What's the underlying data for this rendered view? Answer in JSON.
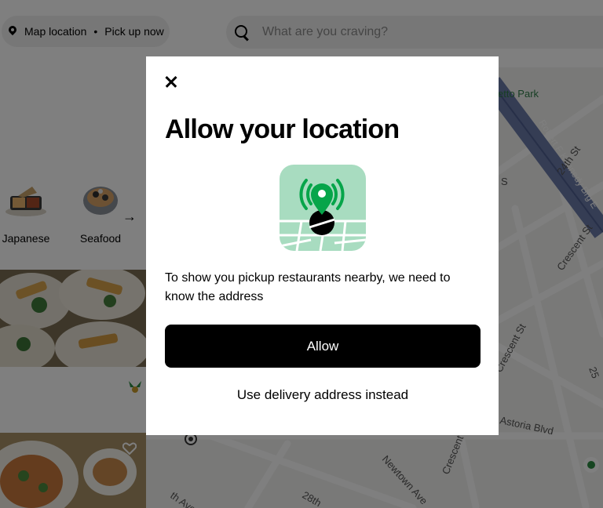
{
  "header": {
    "location_label": "Map location",
    "location_separator": "•",
    "pickup_label": "Pick up now",
    "search_placeholder": "What are you craving?"
  },
  "categories": [
    {
      "label": "Japanese",
      "icon": "sushi-bento-icon"
    },
    {
      "label": "Seafood",
      "icon": "seafood-bowl-icon"
    }
  ],
  "map": {
    "labels": {
      "park": "etto Park",
      "bridge": "Robert F Kennedy Brg E",
      "street_24th": "24th St",
      "crescent_st_1": "Crescent St",
      "crescent_st_2": "Crescent St",
      "crescent_st_3": "Crescent St",
      "street_25": "25",
      "astoria": "Astoria Blvd",
      "newtown": "Newtown Ave",
      "street_28th": "28th",
      "street_th": "th Ave",
      "s_fragment": "S"
    }
  },
  "modal": {
    "title": "Allow your location",
    "body": "To show you pickup restaurants nearby, we need to know the address",
    "allow_label": "Allow",
    "alternate_label": "Use delivery address instead",
    "illustration": "location-pin-map-icon",
    "colors": {
      "accent_green": "#06a54a",
      "map_tile": "#a8dcc0",
      "button": "#000000"
    }
  }
}
